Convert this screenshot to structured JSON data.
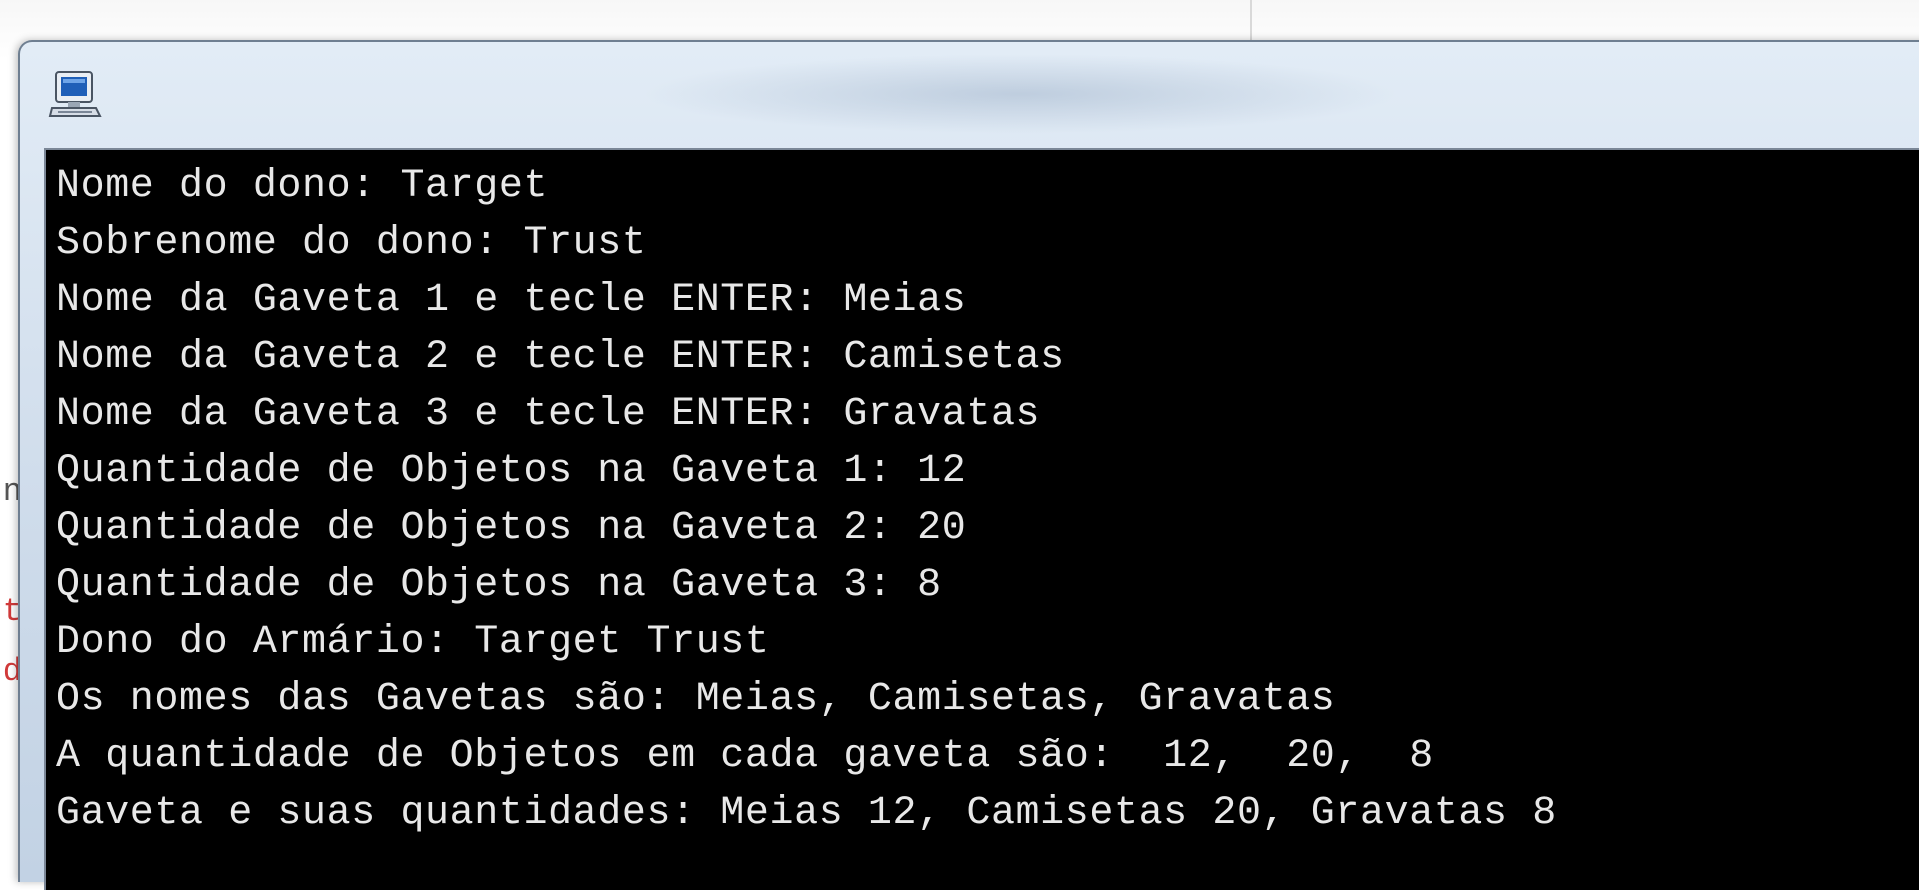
{
  "background": {
    "editor_fragments": [
      "n",
      "t",
      "d"
    ]
  },
  "console": {
    "icon": "console-app-icon",
    "lines": [
      "Nome do dono: Target",
      "Sobrenome do dono: Trust",
      "Nome da Gaveta 1 e tecle ENTER: Meias",
      "Nome da Gaveta 2 e tecle ENTER: Camisetas",
      "Nome da Gaveta 3 e tecle ENTER: Gravatas",
      "Quantidade de Objetos na Gaveta 1: 12",
      "Quantidade de Objetos na Gaveta 2: 20",
      "Quantidade de Objetos na Gaveta 3: 8",
      "Dono do Armário: Target Trust",
      "Os nomes das Gavetas são: Meias, Camisetas, Gravatas",
      "A quantidade de Objetos em cada gaveta são:  12,  20,  8",
      "Gaveta e suas quantidades: Meias 12, Camisetas 20, Gravatas 8"
    ]
  }
}
